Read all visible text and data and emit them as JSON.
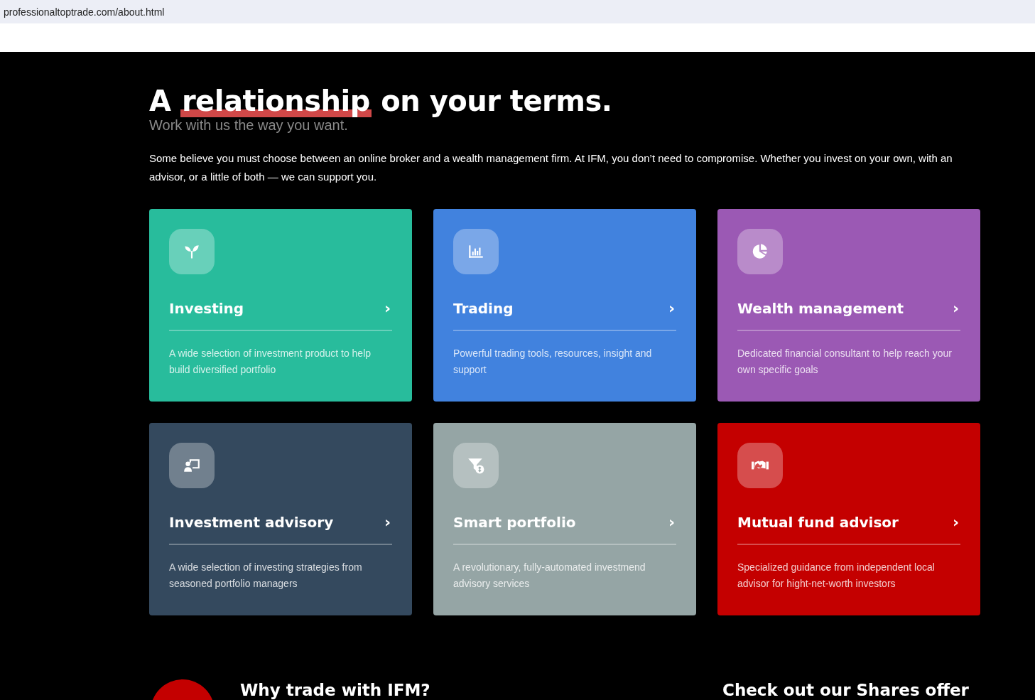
{
  "address_bar": {
    "url": "professionaltoptrade.com/about.html"
  },
  "hero": {
    "heading_before": "A",
    "heading_highlight": "relationship",
    "heading_after": "on your terms.",
    "subheading": "Work with us the way you want.",
    "intro": "Some believe you must choose between an online broker and a wealth management firm. At IFM, you don’t need to compromise. Whether you invest on your own, with an advisor, or a little of both — we can support you."
  },
  "cards": [
    {
      "kind": "sprout",
      "color": "#28bc9c",
      "title": "Investing",
      "arrow": "›",
      "description": "A wide selection of investment product to help build diversified portfolio"
    },
    {
      "kind": "chart",
      "color": "#4182de",
      "title": "Trading",
      "arrow": "›",
      "description": "Powerful trading tools, resources, insight and support"
    },
    {
      "kind": "pie",
      "color": "#9b59b4",
      "title": "Wealth management",
      "arrow": "›",
      "description": "Dedicated financial consultant to help reach your own specific goals"
    },
    {
      "kind": "presenter",
      "color": "#34495e",
      "title": "Investment advisory",
      "arrow": "›",
      "description": "A wide selection of investing strategies from seasoned portfolio managers"
    },
    {
      "kind": "funnel",
      "color": "#95a5a5",
      "title": "Smart portfolio",
      "arrow": "›",
      "description": "A revolutionary, fully-automated investmend advisory services"
    },
    {
      "kind": "handshake",
      "color": "#c40000",
      "title": "Mutual fund advisor",
      "arrow": "›",
      "description": "Specialized guidance from independent local advisor for hight-net-worth investors"
    }
  ],
  "bottom": {
    "left_heading": "Why trade with IFM?",
    "right_heading": "Check out our Shares offer"
  }
}
